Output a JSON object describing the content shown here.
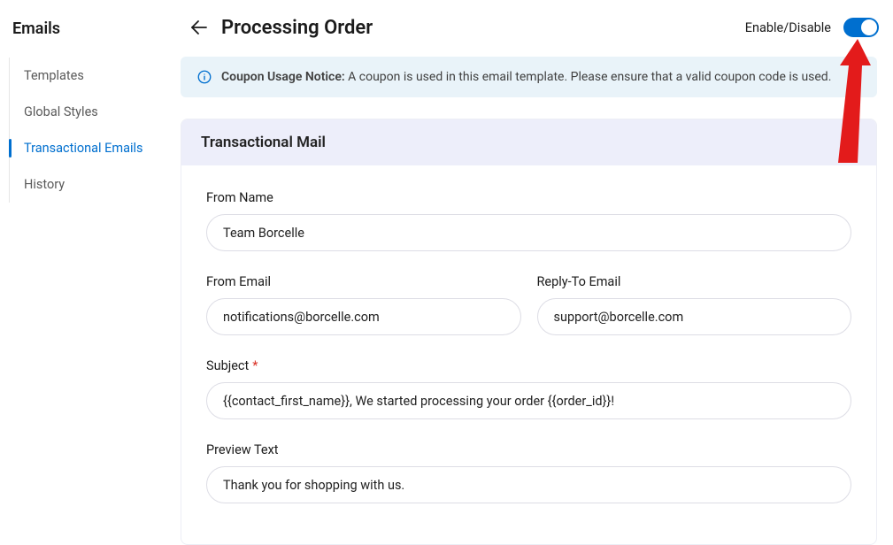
{
  "sidebar": {
    "title": "Emails",
    "items": [
      {
        "label": "Templates"
      },
      {
        "label": "Global Styles"
      },
      {
        "label": "Transactional Emails"
      },
      {
        "label": "History"
      }
    ],
    "activeIndex": 2
  },
  "header": {
    "title": "Processing Order",
    "toggle_label": "Enable/Disable",
    "toggle_on": true
  },
  "notice": {
    "bold": "Coupon Usage Notice:",
    "text": " A coupon is used in this email template. Please ensure that a valid coupon code is used."
  },
  "card": {
    "title": "Transactional Mail",
    "fields": {
      "from_name": {
        "label": "From Name",
        "value": "Team Borcelle"
      },
      "from_email": {
        "label": "From Email",
        "value": "notifications@borcelle.com"
      },
      "reply_to": {
        "label": "Reply-To Email",
        "value": "support@borcelle.com"
      },
      "subject": {
        "label": "Subject",
        "value": "{{contact_first_name}}, We started processing your order {{order_id}}!",
        "required": true
      },
      "preview_text": {
        "label": "Preview Text",
        "value": "Thank you for shopping with us."
      }
    }
  }
}
